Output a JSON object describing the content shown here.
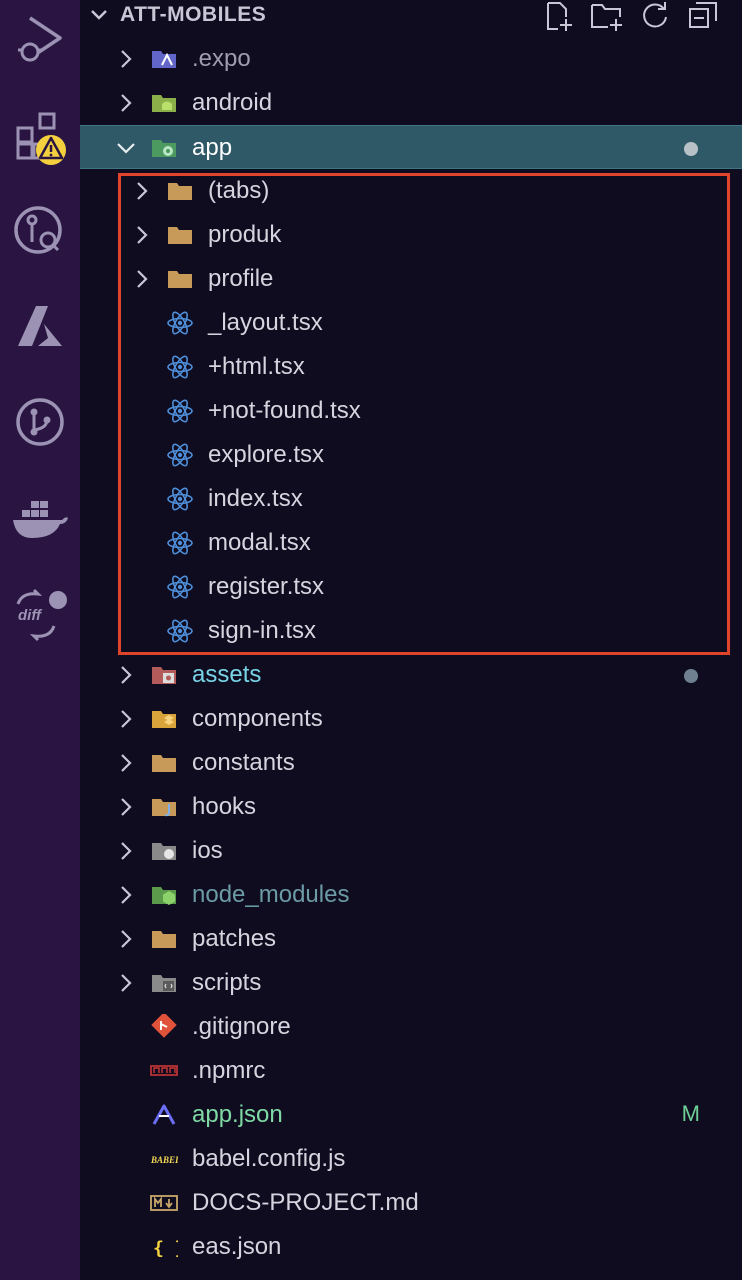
{
  "explorer": {
    "title": "ATT-MOBILES",
    "actions": [
      "new-file",
      "new-folder",
      "refresh",
      "collapse-all"
    ]
  },
  "activity_bar": {
    "items": [
      "run-debug-icon",
      "extensions-warning-icon",
      "source-control-search-icon",
      "azure-icon",
      "git-graph-icon",
      "docker-icon",
      "diff-icon"
    ]
  },
  "tree": [
    {
      "label": ".expo",
      "type": "folder",
      "icon": "expo-folder-icon",
      "depth": 0,
      "expanded": false,
      "style": "muted"
    },
    {
      "label": "android",
      "type": "folder",
      "icon": "android-folder-icon",
      "depth": 0,
      "expanded": false,
      "style": "normal"
    },
    {
      "label": "app",
      "type": "folder",
      "icon": "app-folder-icon",
      "depth": 0,
      "expanded": true,
      "style": "white",
      "selected": true,
      "modified_dot": true
    },
    {
      "label": "(tabs)",
      "type": "folder",
      "icon": "folder-icon",
      "depth": 1,
      "expanded": false,
      "style": "normal"
    },
    {
      "label": "produk",
      "type": "folder",
      "icon": "folder-icon",
      "depth": 1,
      "expanded": false,
      "style": "normal"
    },
    {
      "label": "profile",
      "type": "folder",
      "icon": "folder-icon",
      "depth": 1,
      "expanded": false,
      "style": "normal"
    },
    {
      "label": "_layout.tsx",
      "type": "file",
      "icon": "react-icon",
      "depth": 1,
      "style": "normal"
    },
    {
      "label": "+html.tsx",
      "type": "file",
      "icon": "react-icon",
      "depth": 1,
      "style": "normal"
    },
    {
      "label": "+not-found.tsx",
      "type": "file",
      "icon": "react-icon",
      "depth": 1,
      "style": "normal"
    },
    {
      "label": "explore.tsx",
      "type": "file",
      "icon": "react-icon",
      "depth": 1,
      "style": "normal"
    },
    {
      "label": "index.tsx",
      "type": "file",
      "icon": "react-icon",
      "depth": 1,
      "style": "normal"
    },
    {
      "label": "modal.tsx",
      "type": "file",
      "icon": "react-icon",
      "depth": 1,
      "style": "normal"
    },
    {
      "label": "register.tsx",
      "type": "file",
      "icon": "react-icon",
      "depth": 1,
      "style": "normal"
    },
    {
      "label": "sign-in.tsx",
      "type": "file",
      "icon": "react-icon",
      "depth": 1,
      "style": "normal"
    },
    {
      "label": "assets",
      "type": "folder",
      "icon": "assets-folder-icon",
      "depth": 0,
      "expanded": false,
      "style": "cyan",
      "modified_dot": true
    },
    {
      "label": "components",
      "type": "folder",
      "icon": "components-folder-icon",
      "depth": 0,
      "expanded": false,
      "style": "normal"
    },
    {
      "label": "constants",
      "type": "folder",
      "icon": "folder-icon",
      "depth": 0,
      "expanded": false,
      "style": "normal"
    },
    {
      "label": "hooks",
      "type": "folder",
      "icon": "hooks-folder-icon",
      "depth": 0,
      "expanded": false,
      "style": "normal"
    },
    {
      "label": "ios",
      "type": "folder",
      "icon": "ios-folder-icon",
      "depth": 0,
      "expanded": false,
      "style": "normal"
    },
    {
      "label": "node_modules",
      "type": "folder",
      "icon": "node-modules-folder-icon",
      "depth": 0,
      "expanded": false,
      "style": "teal"
    },
    {
      "label": "patches",
      "type": "folder",
      "icon": "folder-icon",
      "depth": 0,
      "expanded": false,
      "style": "normal"
    },
    {
      "label": "scripts",
      "type": "folder",
      "icon": "scripts-folder-icon",
      "depth": 0,
      "expanded": false,
      "style": "normal"
    },
    {
      "label": ".gitignore",
      "type": "file",
      "icon": "git-icon",
      "depth": 0,
      "style": "normal"
    },
    {
      "label": ".npmrc",
      "type": "file",
      "icon": "npm-icon",
      "depth": 0,
      "style": "normal"
    },
    {
      "label": "app.json",
      "type": "file",
      "icon": "expo-icon",
      "depth": 0,
      "style": "green",
      "git_status": "M"
    },
    {
      "label": "babel.config.js",
      "type": "file",
      "icon": "babel-icon",
      "depth": 0,
      "style": "normal"
    },
    {
      "label": "DOCS-PROJECT.md",
      "type": "file",
      "icon": "markdown-icon",
      "depth": 0,
      "style": "normal"
    },
    {
      "label": "eas.json",
      "type": "file",
      "icon": "json-icon",
      "depth": 0,
      "style": "normal"
    }
  ],
  "colors": {
    "activity_bar": "#2a1542",
    "explorer_bg": "#0f0c1f",
    "selection": "#2f5966",
    "highlight_border": "#e0452b",
    "folder": "#c79a5a",
    "react": "#4f8fd9",
    "modified": "#6fcf97"
  }
}
